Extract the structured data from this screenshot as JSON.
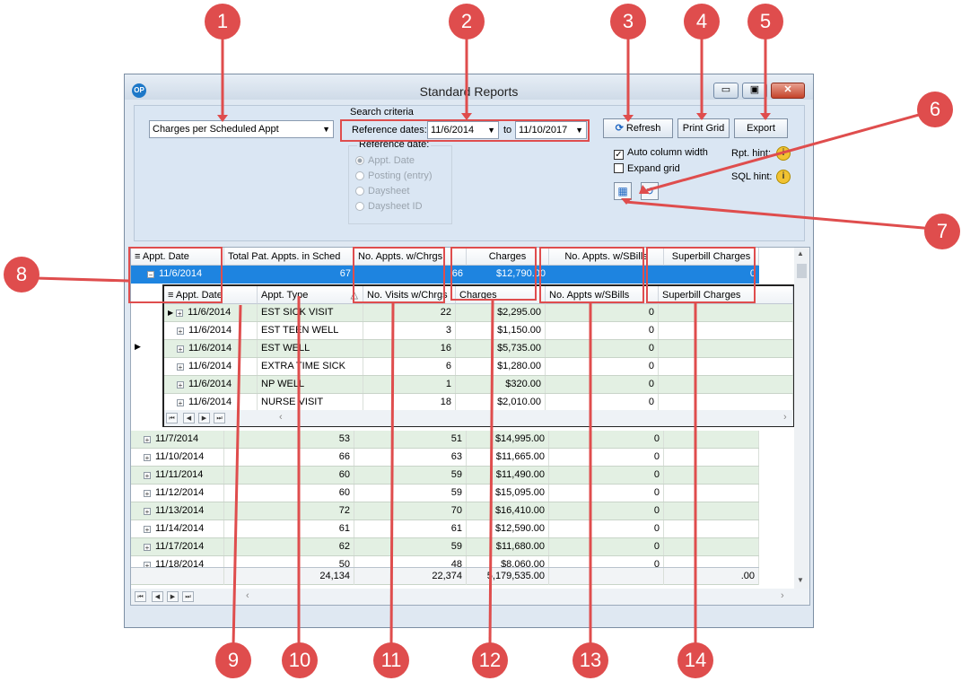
{
  "window": {
    "title": "Standard Reports",
    "logo": "OP",
    "controls": {
      "minimize": "▭",
      "maximize": "▣",
      "close": "✕"
    }
  },
  "criteria": {
    "report": "Charges per Scheduled Appt",
    "group_label": "Search criteria",
    "ref_dates_label": "Reference dates:",
    "from": "11/6/2014",
    "to_label": "to",
    "to": "11/10/2017",
    "ref_date_label": "Reference date:",
    "ref_options": [
      "Appt. Date",
      "Posting (entry)",
      "Daysheet",
      "Daysheet ID"
    ]
  },
  "toolbar": {
    "refresh": "Refresh",
    "print": "Print Grid",
    "export": "Export",
    "auto_col": "Auto column width",
    "expand_grid": "Expand grid",
    "rpt_hint": "Rpt. hint:",
    "sql_hint": "SQL hint:"
  },
  "grid": {
    "headers": [
      "Appt. Date",
      "Total Pat. Appts. in Sched",
      "No. Appts. w/Chrgs",
      "Charges",
      "No. Appts. w/SBills",
      "Superbill Charges"
    ],
    "expanded_row": {
      "date": "11/6/2014",
      "total": "67",
      "chrgs": "66",
      "charges": "$12,790.00",
      "sbills": "",
      "superbill": "0"
    },
    "sub_headers": [
      "Appt. Date",
      "Appt. Type",
      "No. Visits w/Chrgs",
      "Charges",
      "No. Appts w/SBills",
      "Superbill Charges"
    ],
    "sub_rows": [
      {
        "date": "11/6/2014",
        "type": "EST SICK VISIT",
        "visits": "22",
        "charges": "$2,295.00",
        "sbills": "0",
        "superbill": ""
      },
      {
        "date": "11/6/2014",
        "type": "EST TEEN WELL",
        "visits": "3",
        "charges": "$1,150.00",
        "sbills": "0",
        "superbill": ""
      },
      {
        "date": "11/6/2014",
        "type": "EST WELL",
        "visits": "16",
        "charges": "$5,735.00",
        "sbills": "0",
        "superbill": ""
      },
      {
        "date": "11/6/2014",
        "type": "EXTRA TIME SICK",
        "visits": "6",
        "charges": "$1,280.00",
        "sbills": "0",
        "superbill": ""
      },
      {
        "date": "11/6/2014",
        "type": "NP WELL",
        "visits": "1",
        "charges": "$320.00",
        "sbills": "0",
        "superbill": ""
      },
      {
        "date": "11/6/2014",
        "type": "NURSE VISIT",
        "visits": "18",
        "charges": "$2,010.00",
        "sbills": "0",
        "superbill": ""
      }
    ],
    "rows": [
      {
        "date": "11/7/2014",
        "total": "53",
        "chrgs": "51",
        "charges": "$14,995.00",
        "sbills": "0",
        "superbill": ""
      },
      {
        "date": "11/10/2014",
        "total": "66",
        "chrgs": "63",
        "charges": "$11,665.00",
        "sbills": "0",
        "superbill": ""
      },
      {
        "date": "11/11/2014",
        "total": "60",
        "chrgs": "59",
        "charges": "$11,490.00",
        "sbills": "0",
        "superbill": ""
      },
      {
        "date": "11/12/2014",
        "total": "60",
        "chrgs": "59",
        "charges": "$15,095.00",
        "sbills": "0",
        "superbill": ""
      },
      {
        "date": "11/13/2014",
        "total": "72",
        "chrgs": "70",
        "charges": "$16,410.00",
        "sbills": "0",
        "superbill": ""
      },
      {
        "date": "11/14/2014",
        "total": "61",
        "chrgs": "61",
        "charges": "$12,590.00",
        "sbills": "0",
        "superbill": ""
      },
      {
        "date": "11/17/2014",
        "total": "62",
        "chrgs": "59",
        "charges": "$11,680.00",
        "sbills": "0",
        "superbill": ""
      },
      {
        "date": "11/18/2014",
        "total": "50",
        "chrgs": "48",
        "charges": "$8,060.00",
        "sbills": "0",
        "superbill": ""
      }
    ],
    "totals": {
      "total": "24,134",
      "chrgs": "22,374",
      "charges": "5,179,535.00",
      "superbill": ".00"
    }
  },
  "callouts": [
    "1",
    "2",
    "3",
    "4",
    "5",
    "6",
    "7",
    "8",
    "9",
    "10",
    "11",
    "12",
    "13",
    "14"
  ],
  "colors": {
    "callout": "#df4d4d",
    "selected_row": "#1e84e0",
    "alt_row": "#e3f0e3"
  }
}
